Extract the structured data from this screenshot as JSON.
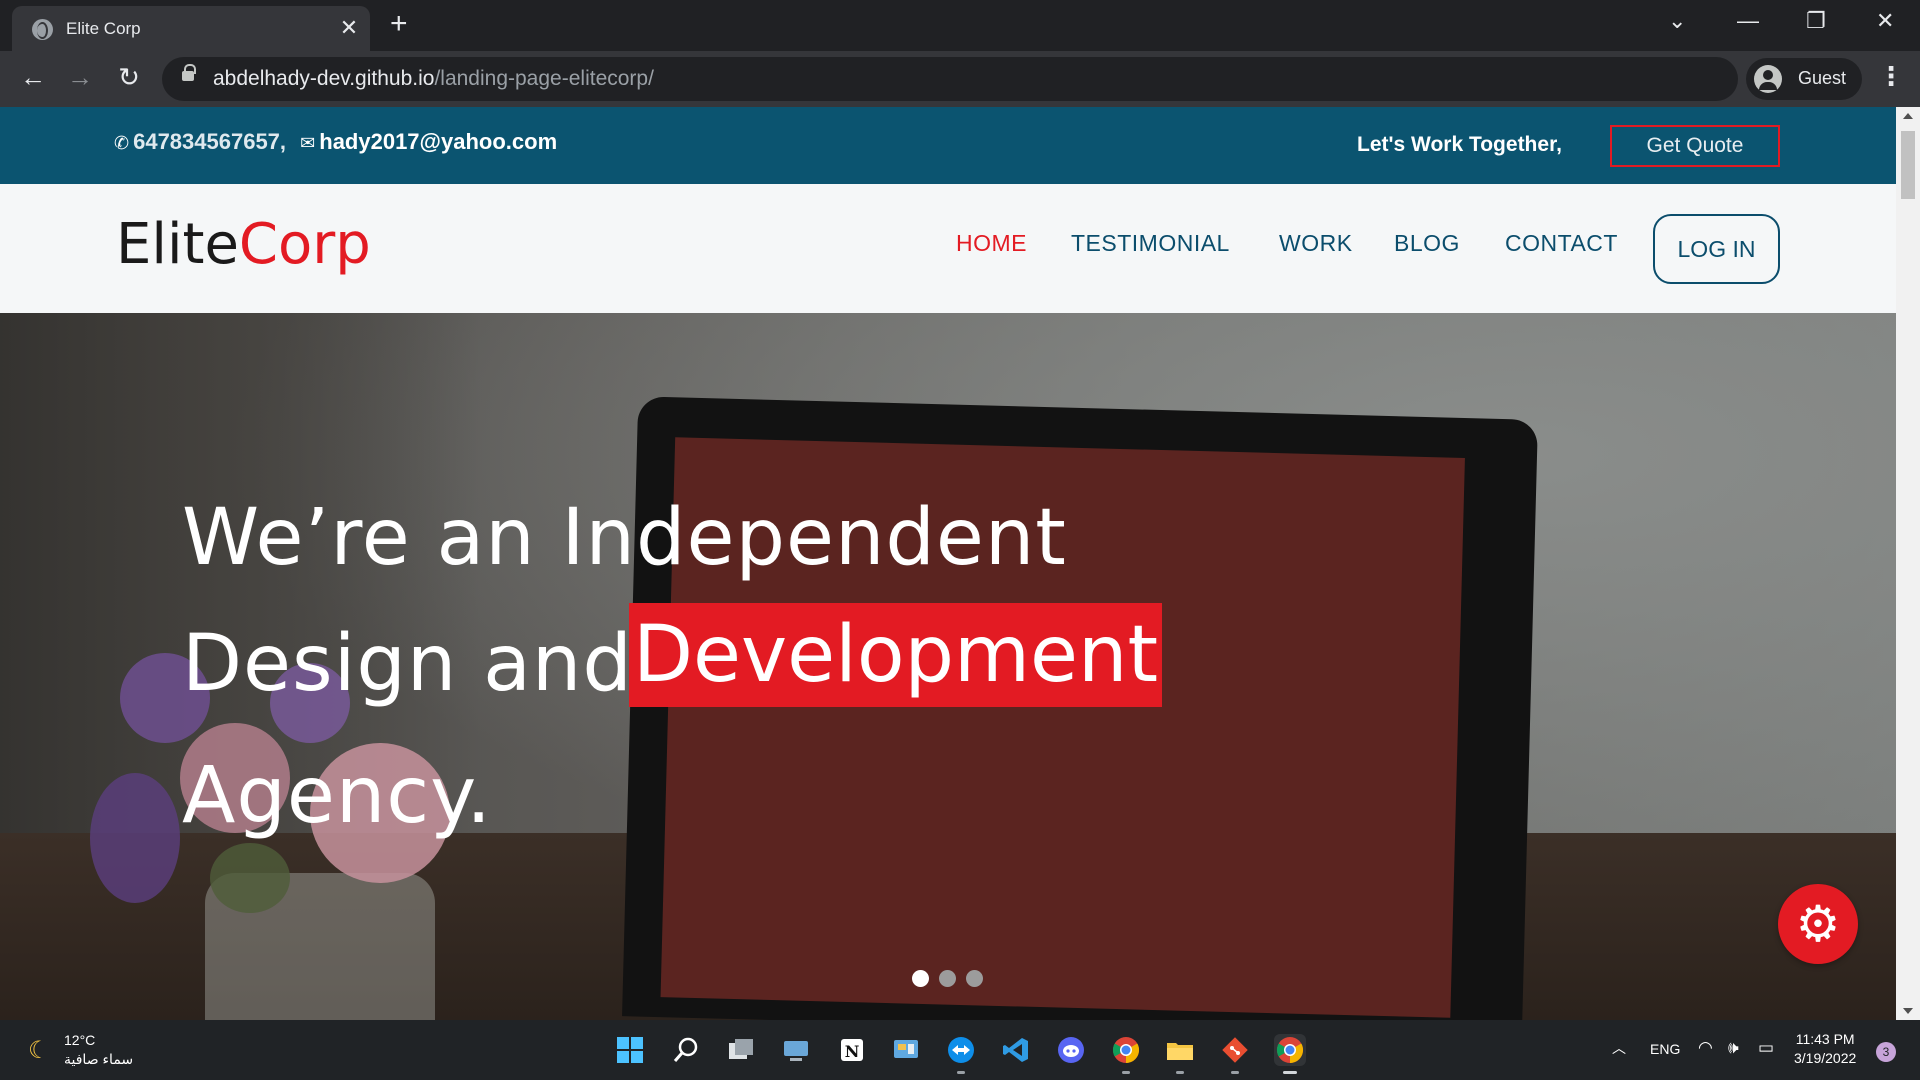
{
  "browser": {
    "tab_title": "Elite Corp",
    "url_host": "abdelhady-dev.github.io",
    "url_path": "/landing-page-elitecorp/",
    "profile_label": "Guest"
  },
  "topbar": {
    "phone": "647834567657,",
    "email": "hady2017@yahoo.com",
    "tagline": "Let's Work Together,",
    "quote_button": "Get Quote"
  },
  "header": {
    "logo_part1": "Elite",
    "logo_part2": "Corp",
    "nav": [
      "HOME",
      "TESTIMONIAL",
      "WORK",
      "BLOG",
      "CONTACT"
    ],
    "login_button": "LOG IN"
  },
  "hero": {
    "line1": "We’re an Independent",
    "line2": "Design and",
    "highlight": "Development",
    "line3": "Agency.",
    "slides_total": 3,
    "slide_active": 1
  },
  "taskbar": {
    "temperature": "12°C",
    "weather_condition": "سماء صافية",
    "language": "ENG",
    "time": "11:43 PM",
    "date": "3/19/2022",
    "notification_count": "3"
  },
  "colors": {
    "accent_red": "#e31b23",
    "topbar_blue": "#0b5470",
    "nav_blue": "#0b4d6c"
  }
}
